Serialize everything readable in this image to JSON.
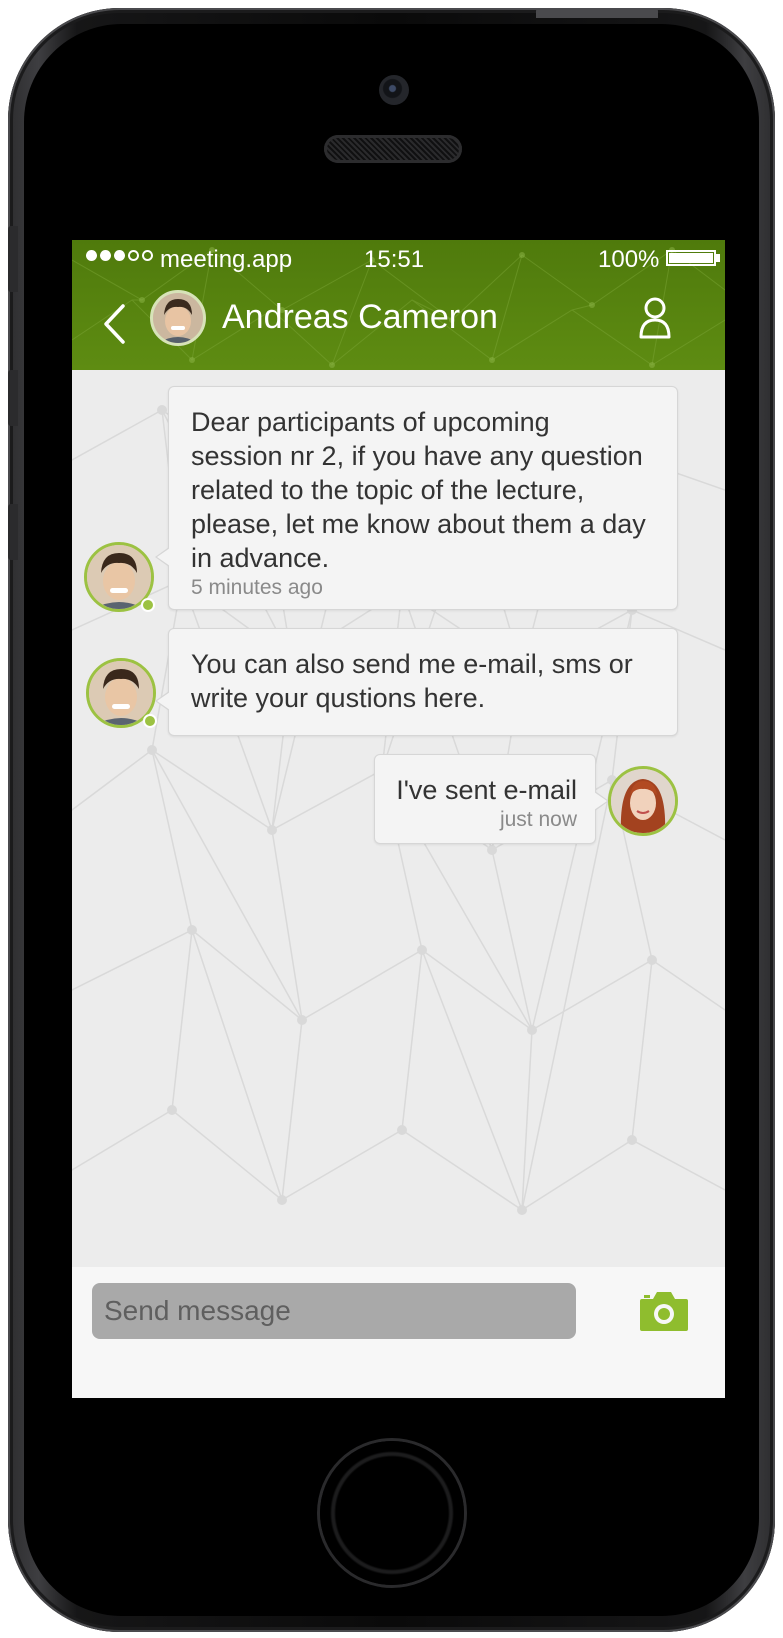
{
  "status_bar": {
    "carrier": "meeting.app",
    "time": "15:51",
    "battery": "100%",
    "battery_level": 1.0
  },
  "header": {
    "contact_name": "Andreas Cameron",
    "back_icon": "chevron-left-icon",
    "profile_icon": "person-icon"
  },
  "messages": [
    {
      "direction": "incoming",
      "lines": [
        "Dear participants of upcoming",
        "session nr 2, if you have any question",
        "related to the topic of the lecture,",
        "please, let me know about them a day",
        "in advance."
      ],
      "time": "5 minutes ago"
    },
    {
      "direction": "incoming",
      "lines": [
        "You can also send me e-mail, sms or",
        "write your qustions here."
      ],
      "time": ""
    },
    {
      "direction": "outgoing",
      "lines": [
        "I've sent e-mail"
      ],
      "time": "just now"
    }
  ],
  "composer": {
    "placeholder": "Send message",
    "camera_icon": "camera-icon"
  },
  "colors": {
    "header_green": "#5e8c12",
    "accent_green": "#9cc242",
    "chat_background": "#ececec"
  }
}
